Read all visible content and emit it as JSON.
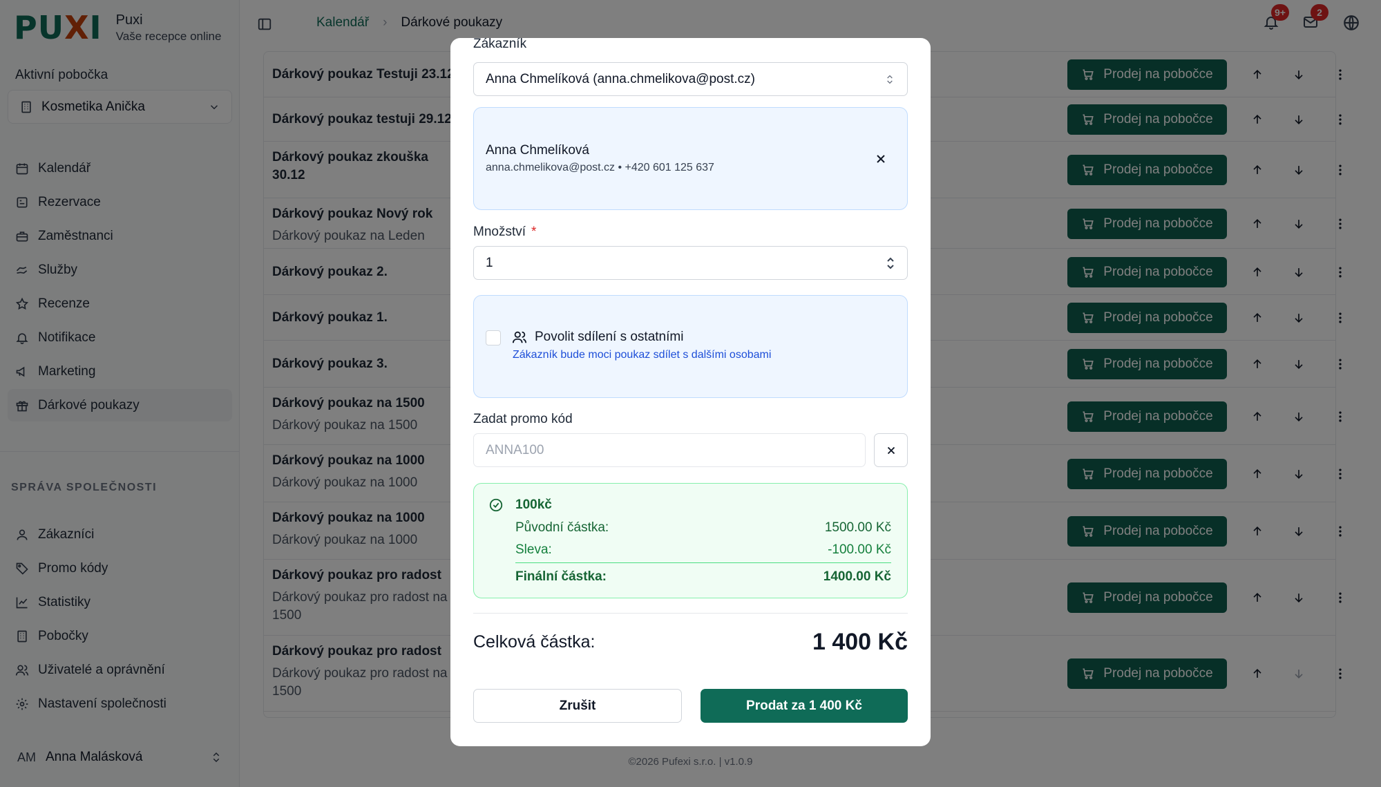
{
  "brand": {
    "logo": "PUXI",
    "name": "Puxi",
    "tagline": "Vaše recepce online"
  },
  "sidebar": {
    "branch_label": "Aktivní pobočka",
    "branch_value": "Kosmetika Anička",
    "nav": [
      "Kalendář",
      "Rezervace",
      "Zaměstnanci",
      "Služby",
      "Recenze",
      "Notifikace",
      "Marketing",
      "Dárkové poukazy"
    ],
    "section_title": "SPRÁVA SPOLEČNOSTI",
    "company_nav": [
      "Zákazníci",
      "Promo kódy",
      "Statistiky",
      "Pobočky",
      "Uživatelé a oprávnění",
      "Nastavení společnosti"
    ],
    "user": {
      "initials": "AM",
      "name": "Anna Malásková"
    }
  },
  "header": {
    "breadcrumb": [
      "Kalendář",
      "Dárkové poukazy"
    ],
    "notifications_badge": "9+",
    "mail_badge": "2"
  },
  "list": {
    "sell_label": "Prodej na pobočce",
    "rows": [
      {
        "title": "Dárkový poukaz Testuji 23.12",
        "subtitle": ""
      },
      {
        "title": "Dárkový poukaz testuji 29.12",
        "subtitle": ""
      },
      {
        "title": "Dárkový poukaz zkouška",
        "title2": "30.12",
        "subtitle": ""
      },
      {
        "title": "Dárkový poukaz Nový rok",
        "subtitle": "Dárkový poukaz na Leden"
      },
      {
        "title": "Dárkový poukaz 2.",
        "subtitle": ""
      },
      {
        "title": "Dárkový poukaz 1.",
        "subtitle": ""
      },
      {
        "title": "Dárkový poukaz 3.",
        "subtitle": ""
      },
      {
        "title": "Dárkový poukaz na 1500",
        "subtitle": "Dárkový poukaz na 1500"
      },
      {
        "title": "Dárkový poukaz na 1000",
        "subtitle": "Dárkový poukaz na 1000"
      },
      {
        "title": "Dárkový poukaz na 1000",
        "subtitle": "Dárkový poukaz na 1000"
      },
      {
        "title": "Dárkový poukaz pro radost",
        "subtitle": "Dárkový poukaz pro radost na",
        "subtitle2": "1500"
      },
      {
        "title": "Dárkový poukaz pro radost",
        "subtitle": "Dárkový poukaz pro radost na",
        "subtitle2": "1500"
      }
    ]
  },
  "footer": "©2026 Pufexi s.r.o.  |  v1.0.9",
  "modal": {
    "customer_label": "Zákazník",
    "customer_select": "Anna Chmelíková (anna.chmelikova@post.cz)",
    "customer_name": "Anna Chmelíková",
    "customer_contact": "anna.chmelikova@post.cz • +420 601 125 637",
    "quantity_label": "Množství",
    "quantity_required": "*",
    "quantity_value": "1",
    "share_title": "Povolit sdílení s ostatními",
    "share_desc": "Zákazník bude moci poukaz sdílet s dalšími osobami",
    "promo_label": "Zadat promo kód",
    "promo_placeholder": "ANNA100",
    "promo_name": "100kč",
    "original_label": "Původní částka:",
    "original_value": "1500.00 Kč",
    "discount_label": "Sleva:",
    "discount_value": "-100.00 Kč",
    "final_label": "Finální částka:",
    "final_value": "1400.00 Kč",
    "total_label": "Celková částka:",
    "total_value": "1 400 Kč",
    "cancel_label": "Zrušit",
    "sell_label": "Prodat za 1 400 Kč"
  },
  "colors": {
    "primary": "#0f6b57",
    "button_dark": "#0f5e4e",
    "danger": "#dc2626",
    "link_blue": "#1d4ed8"
  }
}
